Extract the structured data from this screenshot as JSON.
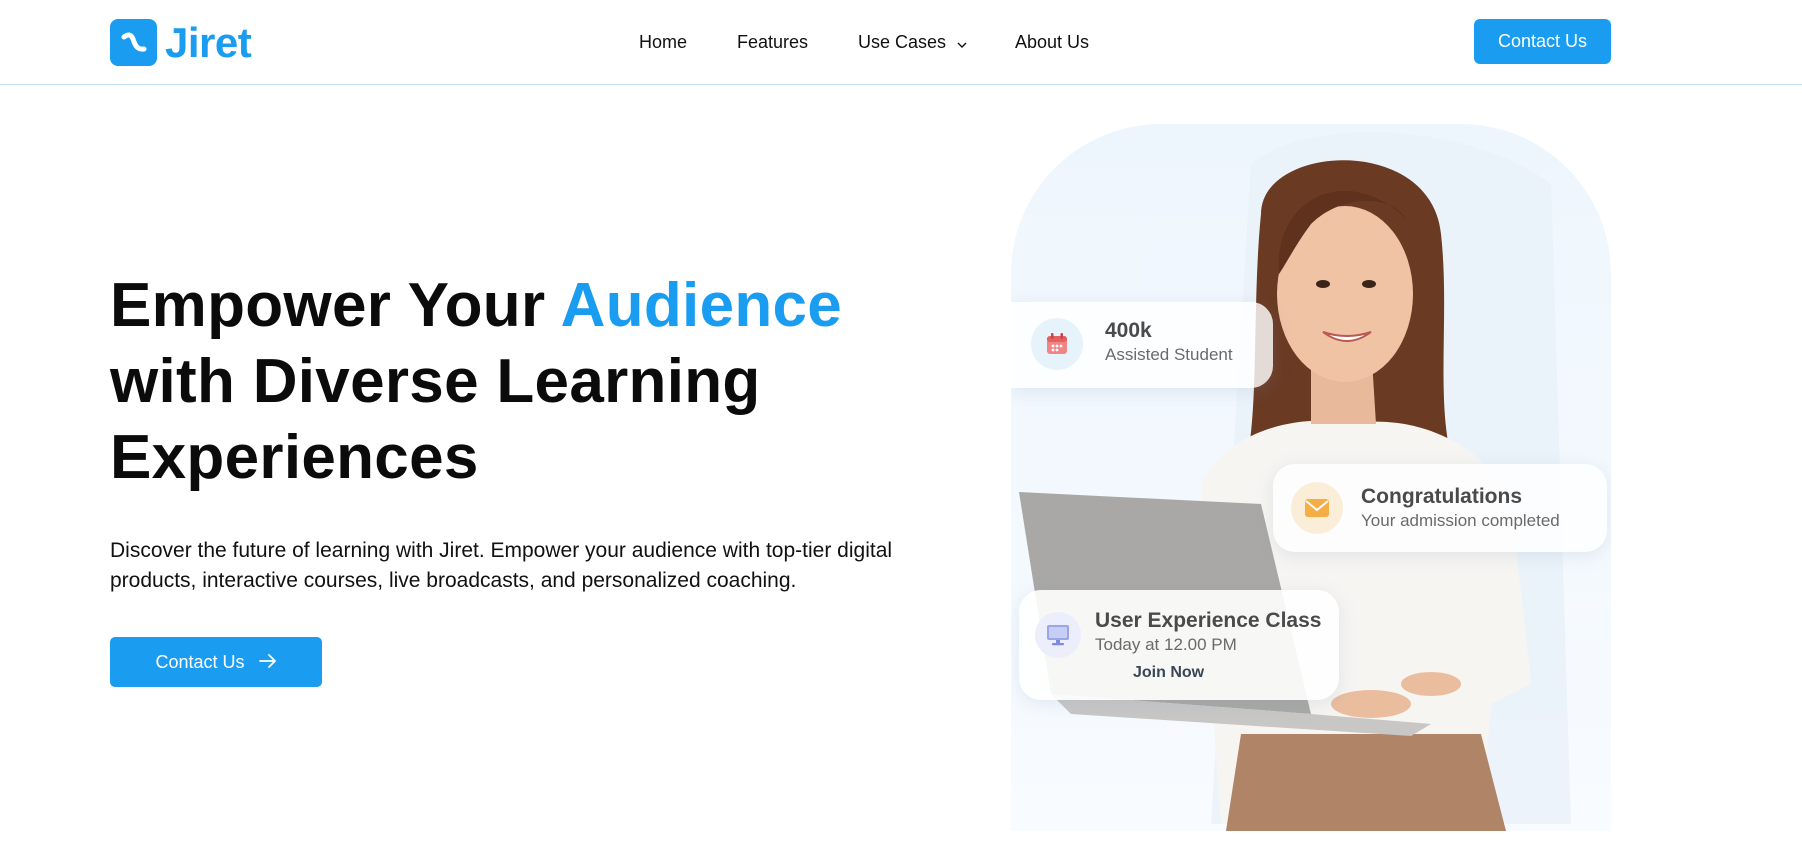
{
  "brand": {
    "name": "Jiret",
    "accent_color": "#1a9df0",
    "logo_icon": "logo-icon"
  },
  "nav": {
    "items": [
      {
        "label": "Home"
      },
      {
        "label": "Features"
      },
      {
        "label": "Use Cases",
        "has_dropdown": true
      },
      {
        "label": "About Us"
      }
    ],
    "cta_label": "Contact Us"
  },
  "hero": {
    "title_part1": "Empower Your ",
    "title_accent": "Audience",
    "title_part2": "with Diverse Learning Experiences",
    "description": "Discover the future of learning with Jiret. Empower your audience with top-tier digital products, interactive courses, live broadcasts, and personalized coaching.",
    "cta_label": "Contact Us",
    "cta_icon": "arrow-right-icon"
  },
  "cards": {
    "students": {
      "icon": "calendar-icon",
      "value": "400k",
      "label": "Assisted Student"
    },
    "admission": {
      "icon": "mail-icon",
      "title": "Congratulations",
      "subtitle": "Your admission completed"
    },
    "class": {
      "icon": "monitor-icon",
      "title": "User Experience Class",
      "time": "Today at 12.00 PM",
      "action": "Join Now"
    }
  }
}
